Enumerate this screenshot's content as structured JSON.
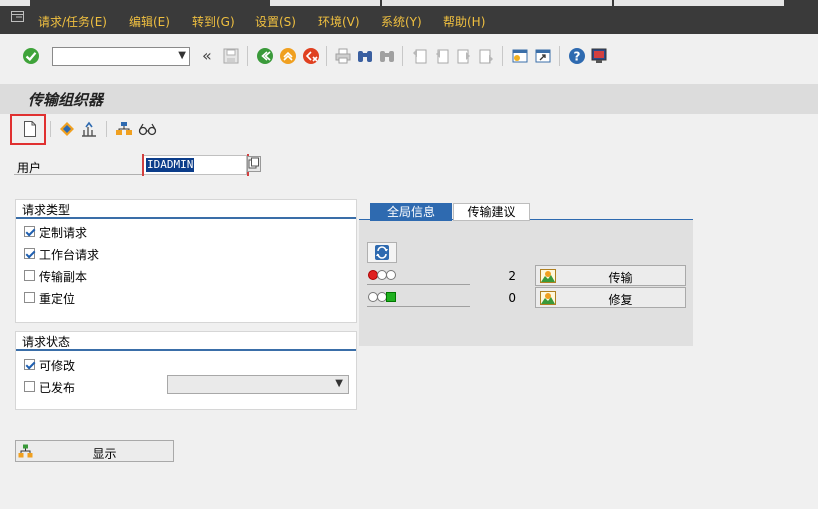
{
  "menubar": {
    "items": [
      "请求/任务(E)",
      "编辑(E)",
      "转到(G)",
      "设置(S)",
      "环境(V)",
      "系统(Y)",
      "帮助(H)"
    ]
  },
  "toolbar": {
    "command_field_value": "",
    "back_fast_glyph": "«"
  },
  "title": "传输组织器",
  "user": {
    "label": "用户",
    "value": "IDADMIN"
  },
  "request_type": {
    "title": "请求类型",
    "options": [
      {
        "label": "定制请求",
        "checked": true
      },
      {
        "label": "工作台请求",
        "checked": true
      },
      {
        "label": "传输副本",
        "checked": false
      },
      {
        "label": "重定位",
        "checked": false
      }
    ]
  },
  "request_status": {
    "title": "请求状态",
    "options": [
      {
        "label": "可修改",
        "checked": true
      },
      {
        "label": "已发布",
        "checked": false
      }
    ],
    "released_select_value": ""
  },
  "tabs": [
    "全局信息",
    "传输建议"
  ],
  "global_info": {
    "rows": [
      {
        "count": "2",
        "button": "传输",
        "light": "red"
      },
      {
        "count": "0",
        "button": "修复",
        "light": "green"
      }
    ]
  },
  "display_button": "显示",
  "colors": {
    "menubar_bg": "#3a3a3a",
    "menu_text": "#f0c040",
    "accent_blue": "#2e6ab0",
    "highlight_red": "#e03030"
  }
}
